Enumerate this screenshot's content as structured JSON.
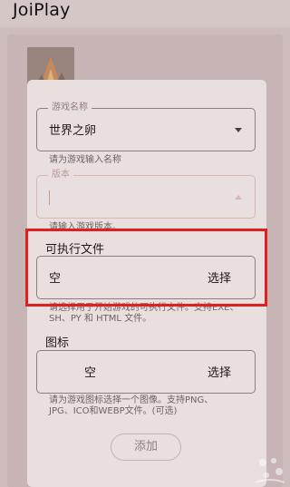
{
  "app": {
    "title": "JoiPlay"
  },
  "form": {
    "name": {
      "label": "游戏名称",
      "value": "世界之卵",
      "helper": "请为游戏输入名称"
    },
    "version": {
      "label": "版本",
      "value": "",
      "helper": "请输入游戏版本。"
    },
    "executable": {
      "title": "可执行文件",
      "value": "空",
      "button": "选择",
      "helper_line1": "请选择用于开始游戏的可执行文件。支持EXE、",
      "helper_line2": "SH、PY 和 HTML 文件。"
    },
    "icon": {
      "title": "图标",
      "value": "空",
      "button": "选择",
      "helper_line1": "请为游戏图标选择一个图像。支持PNG、",
      "helper_line2": "JPG、ICO和WEBP文件。(可选)"
    },
    "add_button": "添加"
  },
  "colors": {
    "highlight": "#e0201f",
    "dialog_bg": "#eadfdf",
    "backdrop": "#cdbdbd"
  },
  "icons": [
    "game-thumbnail-icon",
    "dropdown-arrow-icon",
    "watermark-icon"
  ]
}
